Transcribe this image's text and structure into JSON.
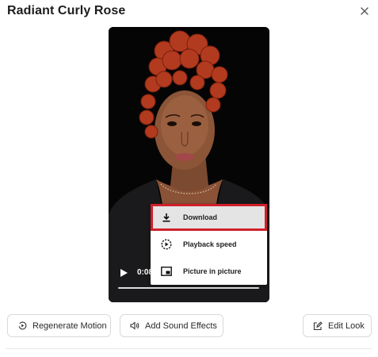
{
  "header": {
    "title": "Radiant Curly Rose",
    "close_icon": "close-icon"
  },
  "video": {
    "current_time": "0:08",
    "playing": false
  },
  "context_menu": {
    "items": [
      {
        "label": "Download",
        "icon": "download-icon",
        "highlighted": true
      },
      {
        "label": "Playback speed",
        "icon": "playback-speed-icon",
        "highlighted": false
      },
      {
        "label": "Picture in picture",
        "icon": "picture-in-picture-icon",
        "highlighted": false
      }
    ],
    "highlight_color": "#d0202a"
  },
  "actions": {
    "regenerate_label": "Regenerate Motion",
    "add_sound_label": "Add Sound Effects",
    "edit_look_label": "Edit Look"
  }
}
